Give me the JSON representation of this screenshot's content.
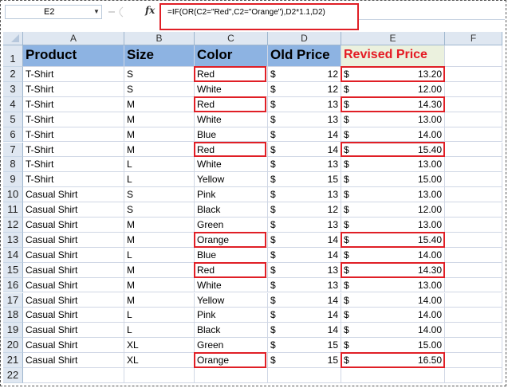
{
  "formula_bar": {
    "name_box": "E2",
    "formula": "=IF(OR(C2=\"Red\",C2=\"Orange\"),D2*1.1,D2)",
    "fx_label": "fx",
    "dropdown_icon": "chevron-down-icon"
  },
  "columns": [
    "A",
    "B",
    "C",
    "D",
    "E",
    "F"
  ],
  "rows": [
    "1",
    "2",
    "3",
    "4",
    "5",
    "6",
    "7",
    "8",
    "9",
    "10",
    "11",
    "12",
    "13",
    "14",
    "15",
    "16",
    "17",
    "18",
    "19",
    "20",
    "21",
    "22"
  ],
  "headers": {
    "product": "Product",
    "size": "Size",
    "color": "Color",
    "old_price": "Old Price",
    "revised_price": "Revised Price"
  },
  "currency_symbol": "$",
  "data_rows": [
    {
      "product": "T-Shirt",
      "size": "S",
      "color": "Red",
      "old": "12",
      "revised": "13.20",
      "highlight": true
    },
    {
      "product": "T-Shirt",
      "size": "S",
      "color": "White",
      "old": "12",
      "revised": "12.00",
      "highlight": false
    },
    {
      "product": "T-Shirt",
      "size": "M",
      "color": "Red",
      "old": "13",
      "revised": "14.30",
      "highlight": true
    },
    {
      "product": "T-Shirt",
      "size": "M",
      "color": "White",
      "old": "13",
      "revised": "13.00",
      "highlight": false
    },
    {
      "product": "T-Shirt",
      "size": "M",
      "color": "Blue",
      "old": "14",
      "revised": "14.00",
      "highlight": false
    },
    {
      "product": "T-Shirt",
      "size": "M",
      "color": "Red",
      "old": "14",
      "revised": "15.40",
      "highlight": true
    },
    {
      "product": "T-Shirt",
      "size": "L",
      "color": "White",
      "old": "13",
      "revised": "13.00",
      "highlight": false
    },
    {
      "product": "T-Shirt",
      "size": "L",
      "color": "Yellow",
      "old": "15",
      "revised": "15.00",
      "highlight": false
    },
    {
      "product": "Casual Shirt",
      "size": "S",
      "color": "Pink",
      "old": "13",
      "revised": "13.00",
      "highlight": false
    },
    {
      "product": "Casual Shirt",
      "size": "S",
      "color": "Black",
      "old": "12",
      "revised": "12.00",
      "highlight": false
    },
    {
      "product": "Casual Shirt",
      "size": "M",
      "color": "Green",
      "old": "13",
      "revised": "13.00",
      "highlight": false
    },
    {
      "product": "Casual Shirt",
      "size": "M",
      "color": "Orange",
      "old": "14",
      "revised": "15.40",
      "highlight": true
    },
    {
      "product": "Casual Shirt",
      "size": "L",
      "color": "Blue",
      "old": "14",
      "revised": "14.00",
      "highlight": false
    },
    {
      "product": "Casual Shirt",
      "size": "M",
      "color": "Red",
      "old": "13",
      "revised": "14.30",
      "highlight": true
    },
    {
      "product": "Casual Shirt",
      "size": "M",
      "color": "White",
      "old": "13",
      "revised": "13.00",
      "highlight": false
    },
    {
      "product": "Casual Shirt",
      "size": "M",
      "color": "Yellow",
      "old": "14",
      "revised": "14.00",
      "highlight": false
    },
    {
      "product": "Casual Shirt",
      "size": "L",
      "color": "Pink",
      "old": "14",
      "revised": "14.00",
      "highlight": false
    },
    {
      "product": "Casual Shirt",
      "size": "L",
      "color": "Black",
      "old": "14",
      "revised": "14.00",
      "highlight": false
    },
    {
      "product": "Casual Shirt",
      "size": "XL",
      "color": "Green",
      "old": "15",
      "revised": "15.00",
      "highlight": false
    },
    {
      "product": "Casual Shirt",
      "size": "XL",
      "color": "Orange",
      "old": "15",
      "revised": "16.50",
      "highlight": true
    }
  ],
  "colors": {
    "header_fill": "#8db3e2",
    "revised_header_fill": "#ebf1de",
    "revised_header_text": "#e51b24",
    "highlight_border": "#e01f26"
  }
}
